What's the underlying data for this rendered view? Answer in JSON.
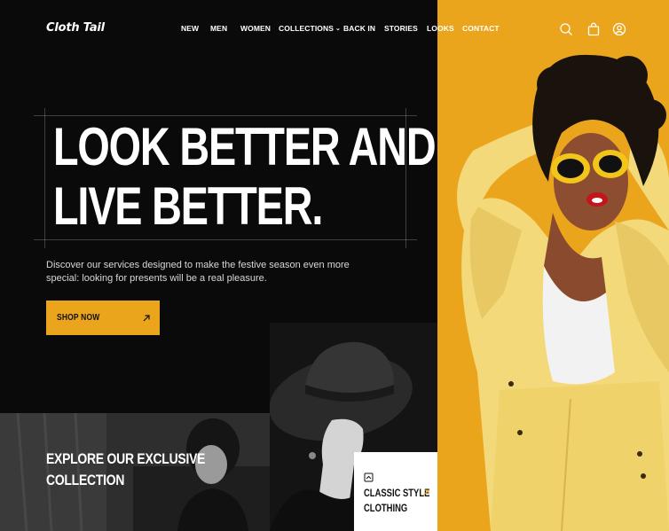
{
  "brand": {
    "logo_text": "Cloth Tail"
  },
  "nav": {
    "items": [
      {
        "label": "NEW"
      },
      {
        "label": "MEN"
      },
      {
        "label": "WOMEN"
      },
      {
        "label": "COLLECTIONS",
        "has_dropdown": true
      },
      {
        "label": "BACK IN"
      },
      {
        "label": "STORIES"
      },
      {
        "label": "LOOKS"
      },
      {
        "label": "CONTACT"
      }
    ]
  },
  "header_icons": [
    "search-icon",
    "bag-icon",
    "user-icon"
  ],
  "hero": {
    "headline_line1": "LOOK BETTER AND",
    "headline_line2": "LIVE BETTER.",
    "subtext": "Discover our services designed to make the festive season even more special: looking for presents will be a real pleasure.",
    "cta_label": "SHOP NOW",
    "cta_icon": "arrow-up-right-icon"
  },
  "tiles": {
    "explore_line1": "EXPLORE OUR EXCLUSIVE",
    "explore_line2": "COLLECTION",
    "classic_line1": "CLASSIC STYLE",
    "classic_line2": "CLOTHING",
    "classic_icon": "hanger-icon",
    "classic_arrow": "arrow-up-right-icon"
  },
  "colors": {
    "background": "#0a0a0a",
    "accent": "#eaa51d",
    "text": "#ffffff"
  }
}
